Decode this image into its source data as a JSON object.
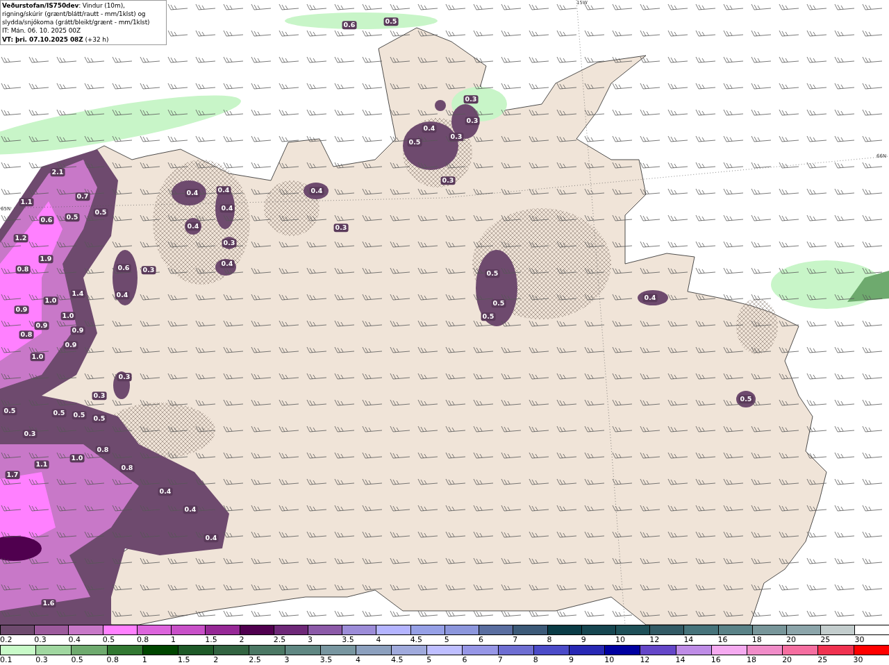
{
  "header": {
    "description": "**Veðurstofan/IS750dev**: Vindur (10m), rigning/skúrir (grænt/blátt/rautt - mm/1klst) og slydda/snjókoma (grátt/bleikt/grænt - mm/1klst)",
    "issue_time": "IT: Mán. 06. 10. 2025 00Z",
    "valid_time": "**VT: þri. 07.10.2025 08Z** (+32 h)"
  },
  "map": {
    "grid_labels": [
      "15W",
      "66N",
      "65N"
    ],
    "value_labels": [
      "0.6",
      "0.5",
      "0.3",
      "0.4",
      "0.3",
      "0.5",
      "0.3",
      "0.3",
      "2.1",
      "0.7",
      "1.1",
      "0.5",
      "0.6",
      "0.5",
      "0.4",
      "0.4",
      "0.4",
      "0.4",
      "0.4",
      "0.3",
      "0.3",
      "0.4",
      "1.2",
      "1.9",
      "0.8",
      "0.6",
      "0.3",
      "0.5",
      "1.4",
      "0.4",
      "1.0",
      "0.9",
      "0.5",
      "0.4",
      "1.0",
      "0.9",
      "0.9",
      "0.8",
      "0.9",
      "0.5",
      "1.0",
      "0.3",
      "0.3",
      "0.5",
      "0.5",
      "0.5",
      "0.5",
      "0.5",
      "0.3",
      "0.8",
      "1.1",
      "1.0",
      "0.8",
      "1.7",
      "0.4",
      "0.4",
      "0.4",
      "1.6"
    ]
  },
  "legends": [
    {
      "items": [
        {
          "label": "0.2",
          "color": "#6e4a6e"
        },
        {
          "label": "0.3",
          "color": "#9c5a9c"
        },
        {
          "label": "0.4",
          "color": "#c878c8"
        },
        {
          "label": "0.5",
          "color": "#ff80ff"
        },
        {
          "label": "0.8",
          "color": "#dc64dc"
        },
        {
          "label": "1",
          "color": "#c850c8"
        },
        {
          "label": "1.5",
          "color": "#962896"
        },
        {
          "label": "2",
          "color": "#50004f"
        },
        {
          "label": "2.5",
          "color": "#6e2878"
        },
        {
          "label": "3",
          "color": "#8c5aa8"
        },
        {
          "label": "3.5",
          "color": "#9c8cd8"
        },
        {
          "label": "4",
          "color": "#b4b4ff"
        },
        {
          "label": "4.5",
          "color": "#96a0e6"
        },
        {
          "label": "5",
          "color": "#8c96dc"
        },
        {
          "label": "6",
          "color": "#5a6ea0"
        },
        {
          "label": "7",
          "color": "#3c5a78"
        },
        {
          "label": "8",
          "color": "#0a3c46"
        },
        {
          "label": "9",
          "color": "#164650"
        },
        {
          "label": "10",
          "color": "#1e5058"
        },
        {
          "label": "12",
          "color": "#325a64"
        },
        {
          "label": "14",
          "color": "#46737a"
        },
        {
          "label": "16",
          "color": "#5a8287"
        },
        {
          "label": "18",
          "color": "#78969a"
        },
        {
          "label": "20",
          "color": "#8ca5aa"
        },
        {
          "label": "25",
          "color": "#c3cdcd"
        },
        {
          "label": "30",
          "color": "#ffffff"
        }
      ]
    },
    {
      "items": [
        {
          "label": "0.1",
          "color": "#c8fac8"
        },
        {
          "label": "0.3",
          "color": "#a0d7a0"
        },
        {
          "label": "0.5",
          "color": "#6eaa6e"
        },
        {
          "label": "0.8",
          "color": "#327832"
        },
        {
          "label": "1",
          "color": "#004600"
        },
        {
          "label": "1.5",
          "color": "#1e5a28"
        },
        {
          "label": "2",
          "color": "#326441"
        },
        {
          "label": "2.5",
          "color": "#4b7864"
        },
        {
          "label": "3",
          "color": "#5f8782"
        },
        {
          "label": "3.5",
          "color": "#7896a0"
        },
        {
          "label": "4",
          "color": "#8ca0be"
        },
        {
          "label": "4.5",
          "color": "#a0aadc"
        },
        {
          "label": "5",
          "color": "#bebeff"
        },
        {
          "label": "6",
          "color": "#9696e6"
        },
        {
          "label": "7",
          "color": "#6e6ed2"
        },
        {
          "label": "8",
          "color": "#4b4bc8"
        },
        {
          "label": "9",
          "color": "#2828b4"
        },
        {
          "label": "10",
          "color": "#0000a0"
        },
        {
          "label": "12",
          "color": "#6446c8"
        },
        {
          "label": "14",
          "color": "#be8ce6"
        },
        {
          "label": "16",
          "color": "#f5aaf0"
        },
        {
          "label": "18",
          "color": "#f08cc8"
        },
        {
          "label": "20",
          "color": "#f56ea0"
        },
        {
          "label": "25",
          "color": "#f03250"
        },
        {
          "label": "30",
          "color": "#ff0000"
        }
      ]
    }
  ]
}
